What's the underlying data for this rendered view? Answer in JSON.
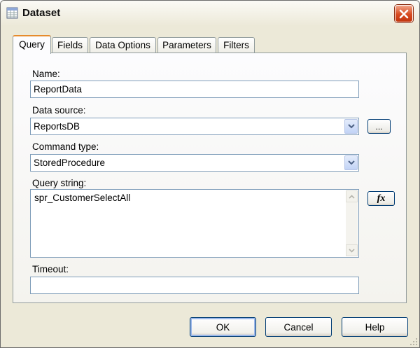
{
  "window": {
    "title": "Dataset"
  },
  "tabs": [
    {
      "label": "Query",
      "active": true
    },
    {
      "label": "Fields",
      "active": false
    },
    {
      "label": "Data Options",
      "active": false
    },
    {
      "label": "Parameters",
      "active": false
    },
    {
      "label": "Filters",
      "active": false
    }
  ],
  "query": {
    "name_label": "Name:",
    "name_value": "ReportData",
    "datasource_label": "Data source:",
    "datasource_value": "ReportsDB",
    "datasource_button": "...",
    "commandtype_label": "Command type:",
    "commandtype_value": "StoredProcedure",
    "querystring_label": "Query string:",
    "querystring_value": "spr_CustomerSelectAll",
    "expression_button": "fx",
    "timeout_label": "Timeout:",
    "timeout_value": ""
  },
  "buttons": {
    "ok": "OK",
    "cancel": "Cancel",
    "help": "Help"
  },
  "colors": {
    "accent_tab": "#e68b2c",
    "close": "#d74a1f",
    "field_border": "#7f9db9",
    "background": "#ece9d8"
  },
  "icons": {
    "title": "dataset-icon",
    "close": "close-icon",
    "dropdown": "chevron-down-icon",
    "scroll_up": "arrow-up-icon",
    "scroll_down": "arrow-down-icon",
    "grip": "resize-grip-icon"
  }
}
